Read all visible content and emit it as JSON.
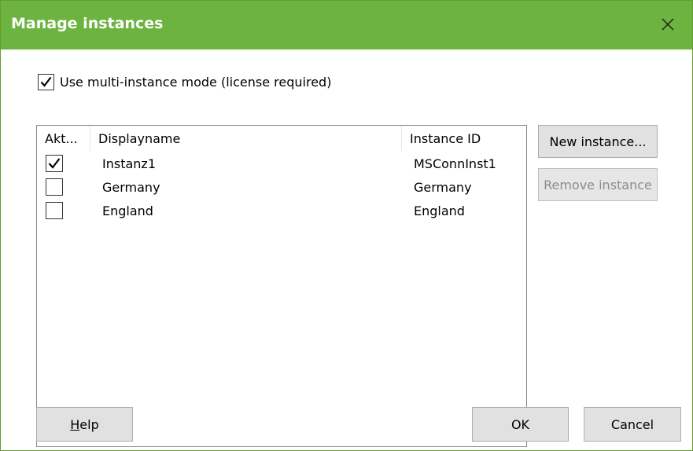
{
  "window": {
    "title": "Manage instances",
    "titlebar_color": "#6cb33f",
    "close_icon": "close-icon"
  },
  "multi_instance": {
    "checked": true,
    "label": "Use multi-instance mode (license required)"
  },
  "instances_table": {
    "columns": [
      "Akt...",
      "Displayname",
      "Instance ID"
    ],
    "rows": [
      {
        "active": true,
        "displayname": "Instanz1",
        "instance_id": "MSConnInst1"
      },
      {
        "active": false,
        "displayname": "Germany",
        "instance_id": "Germany"
      },
      {
        "active": false,
        "displayname": "England",
        "instance_id": "England"
      }
    ]
  },
  "side_buttons": {
    "new_instance": "New instance...",
    "remove_instance": "Remove instance",
    "remove_enabled": false
  },
  "footer": {
    "help_mnemonic": "H",
    "help_rest": "elp",
    "ok": "OK",
    "cancel": "Cancel"
  }
}
